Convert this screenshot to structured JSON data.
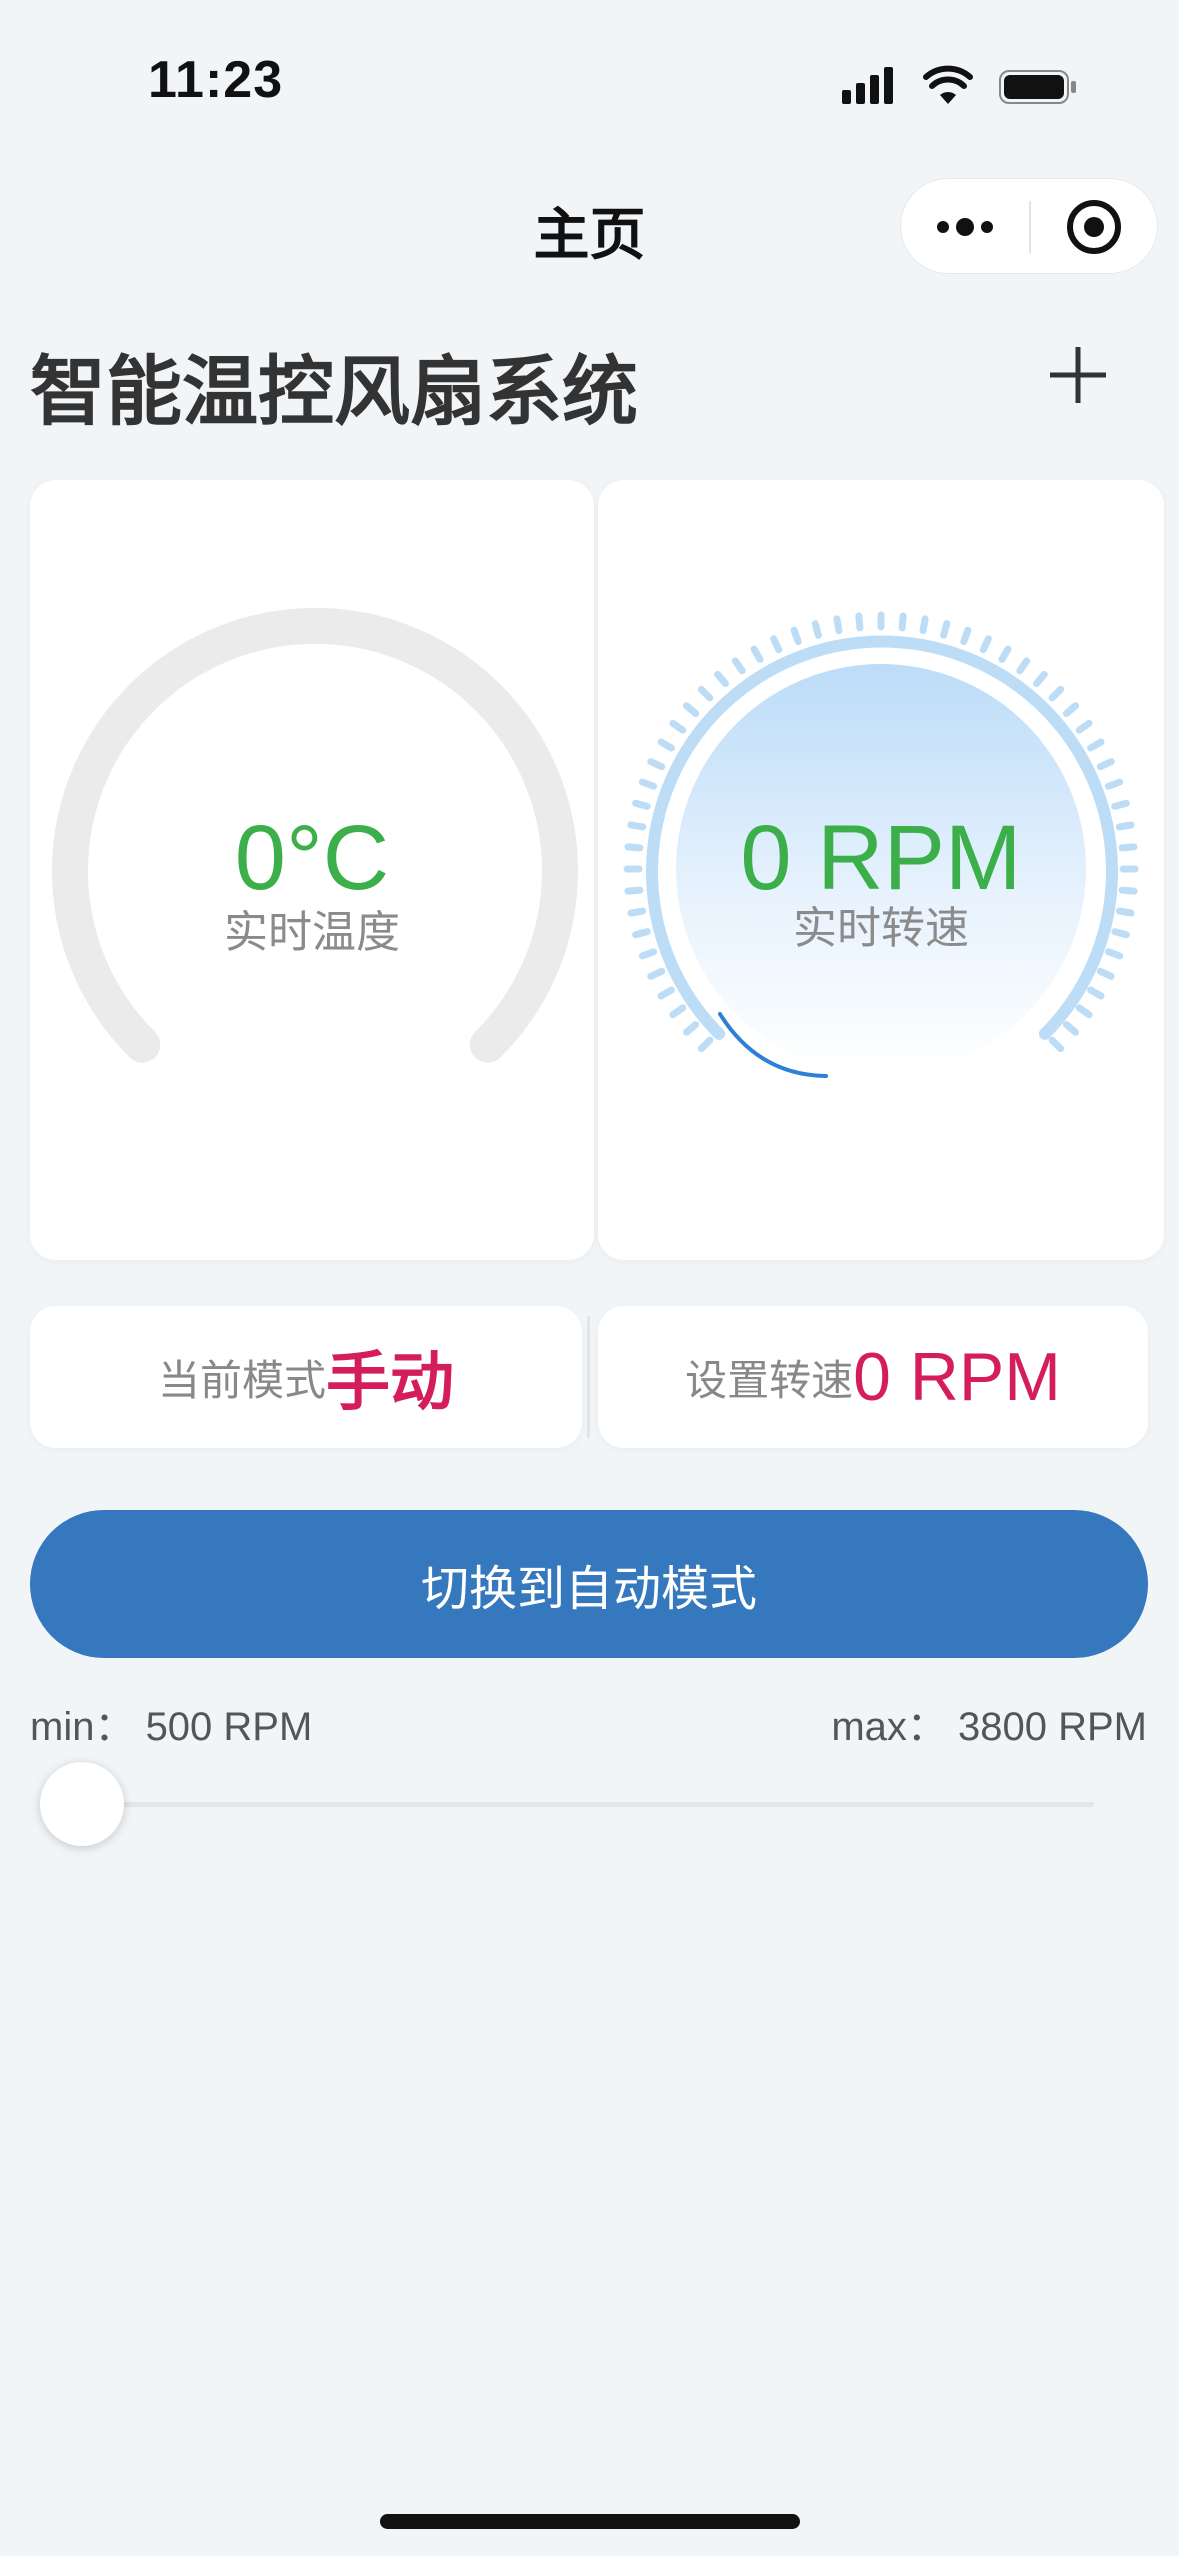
{
  "status_bar": {
    "time": "11:23"
  },
  "nav": {
    "title": "主页"
  },
  "page": {
    "title": "智能温控风扇系统"
  },
  "temperature_gauge": {
    "value": "0°C",
    "label": "实时温度"
  },
  "speed_gauge": {
    "value": "0 RPM",
    "label": "实时转速"
  },
  "mode_card": {
    "label": "当前模式",
    "value": "手动"
  },
  "set_speed_card": {
    "label": "设置转速",
    "value": "0 RPM"
  },
  "toggle_button": {
    "label": "切换到自动模式"
  },
  "slider": {
    "min_label": "min：  500 RPM",
    "max_label": "max：  3800 RPM",
    "position_fraction": 0
  },
  "colors": {
    "accent_green": "#3caf4a",
    "accent_red": "#d41e5c",
    "button_blue": "#3578bd",
    "gauge_blue": "#bddcf6"
  },
  "icons": {
    "more": "more-dots-icon",
    "target": "target-icon",
    "plus": "plus-icon",
    "signal": "signal-icon",
    "wifi": "wifi-icon",
    "battery": "battery-icon"
  }
}
